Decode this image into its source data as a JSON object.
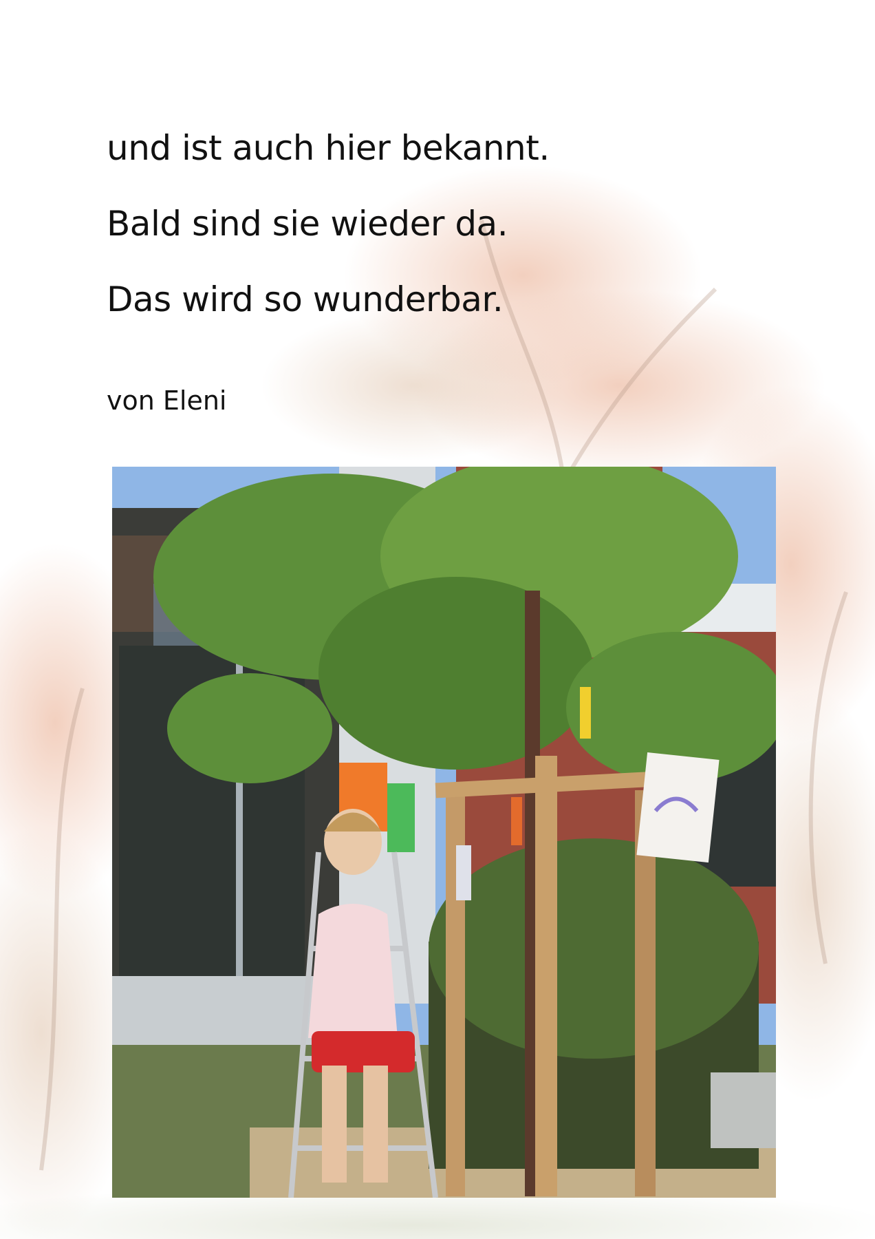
{
  "poem": {
    "lines": [
      "und ist auch hier bekannt.",
      "Bald sind sie wieder da.",
      "Das wird so wunderbar."
    ],
    "author": "von Eleni"
  },
  "photo": {
    "subject": "girl-on-ladder-under-tree-photo"
  }
}
